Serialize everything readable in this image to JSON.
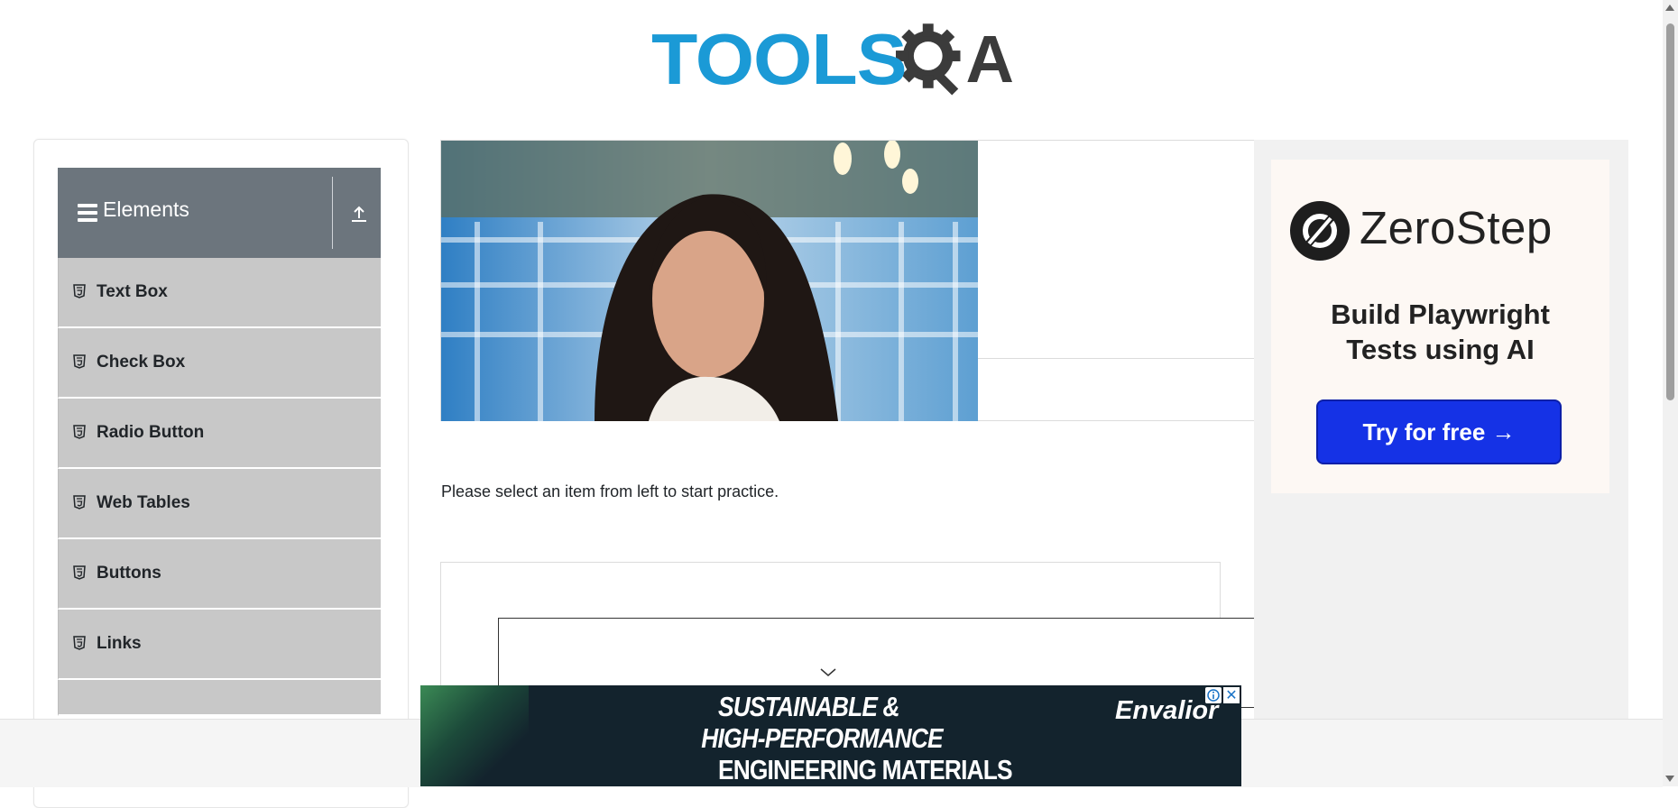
{
  "header": {
    "logo_text_primary": "TOOLS",
    "logo_text_secondary": "A",
    "logo_colors": {
      "primary": "#1b9ad6",
      "secondary": "#3b3b3b"
    }
  },
  "sidebar": {
    "group_title": "Elements",
    "group_icons": {
      "menu": "hamburger-icon",
      "toggle": "collapse-up-icon"
    },
    "items": [
      {
        "label": "Text Box",
        "icon": "html5-icon"
      },
      {
        "label": "Check Box",
        "icon": "html5-icon"
      },
      {
        "label": "Radio Button",
        "icon": "html5-icon"
      },
      {
        "label": "Web Tables",
        "icon": "html5-icon"
      },
      {
        "label": "Buttons",
        "icon": "html5-icon"
      },
      {
        "label": "Links",
        "icon": "html5-icon"
      }
    ]
  },
  "main": {
    "intro_text": "Please select an item from left to start practice."
  },
  "right_ad": {
    "brand": "ZeroStep",
    "tagline_line1": "Build Playwright",
    "tagline_line2": "Tests using AI",
    "cta_label": "Try for free →",
    "colors": {
      "cta": "#1532e6",
      "card": "#fdf8f4"
    }
  },
  "bottom_ad": {
    "line1": "SUSTAINABLE &",
    "line2": "HIGH-PERFORMANCE",
    "line3": "ENGINEERING MATERIALS",
    "brand": "Envalior",
    "close_label": "✕",
    "colors": {
      "background": "#13232d"
    }
  }
}
